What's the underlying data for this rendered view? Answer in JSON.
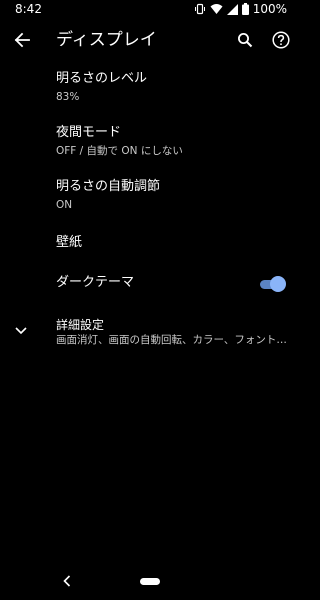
{
  "status_bar": {
    "time": "8:42",
    "battery": "100%",
    "icons": [
      "vibrate-icon",
      "wifi-icon",
      "signal-icon",
      "battery-icon"
    ]
  },
  "app_bar": {
    "title": "ディスプレイ",
    "icons": [
      "back-arrow-icon",
      "search-icon",
      "help-icon"
    ]
  },
  "settings": {
    "brightness": {
      "title": "明るさのレベル",
      "value": "83%"
    },
    "night_mode": {
      "title": "夜間モード",
      "value": "OFF / 自動で ON にしない"
    },
    "adaptive_brightness": {
      "title": "明るさの自動調節",
      "value": "ON"
    },
    "wallpaper": {
      "title": "壁紙"
    },
    "dark_theme": {
      "title": "ダークテーマ",
      "enabled": true
    },
    "advanced": {
      "title": "詳細設定",
      "summary": "画面消灯、画面の自動回転、カラー、フォント…",
      "icon": "chevron-down-icon"
    }
  },
  "nav_bar": {
    "icons": [
      "nav-back-icon",
      "home-pill"
    ]
  },
  "colors": {
    "background": "#000000",
    "text_primary": "#ffffff",
    "text_secondary": "#c9c9c9",
    "accent": "#8ab4f8"
  }
}
